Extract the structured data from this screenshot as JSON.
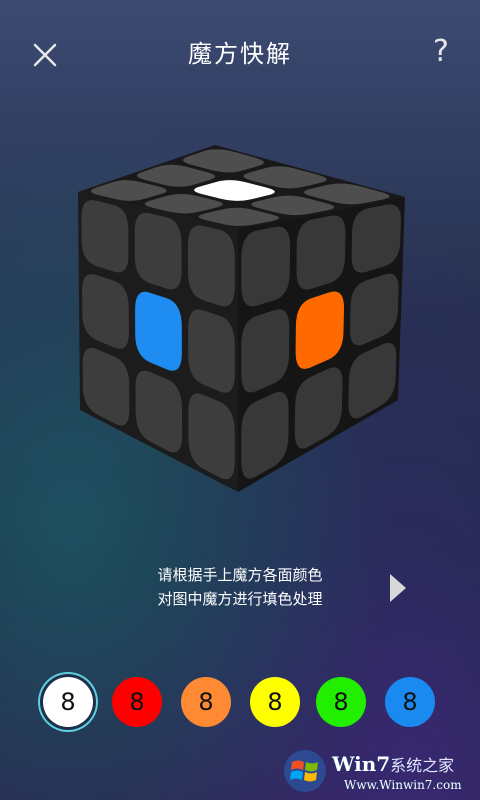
{
  "header": {
    "title": "魔方快解",
    "close_icon": "close-icon",
    "help_label": "?"
  },
  "cube": {
    "body_color": "#3b3b3b",
    "top_center_color": "#ffffff",
    "left_center_color": "#1e8cf0",
    "right_center_color": "#ff6a00"
  },
  "instruction": {
    "line1": "请根据手上魔方各面颜色",
    "line2": "对图中魔方进行填色处理",
    "next_icon": "chevron-right-icon"
  },
  "palette": [
    {
      "name": "white",
      "color": "#ffffff",
      "label": "8",
      "selected": true
    },
    {
      "name": "red",
      "color": "#ff0000",
      "label": "8",
      "selected": false
    },
    {
      "name": "orange",
      "color": "#ff8a33",
      "label": "8",
      "selected": false
    },
    {
      "name": "yellow",
      "color": "#ffff00",
      "label": "8",
      "selected": false
    },
    {
      "name": "green",
      "color": "#22ee00",
      "label": "8",
      "selected": false
    },
    {
      "name": "blue",
      "color": "#1a8af0",
      "label": "8",
      "selected": false
    }
  ],
  "watermark": {
    "brand": "Win7",
    "brand_suffix": "系统之家",
    "url": "Www.Winwin7.com"
  }
}
